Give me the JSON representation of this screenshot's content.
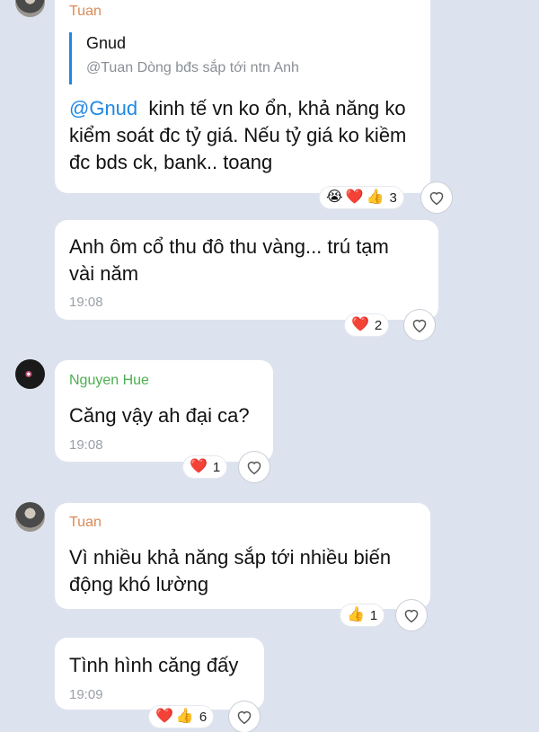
{
  "messages": [
    {
      "sender": "Tuan",
      "quote": {
        "name": "Gnud",
        "text": "@Tuan Dòng bđs sắp tới ntn Anh"
      },
      "mention": "@Gnud",
      "lines": [
        "kinh tế vn ko ổn, khả năng ko",
        "kiểm soát đc tỷ giá. Nếu tỷ giá ko kiềm",
        "đc bds ck, bank.. toang"
      ],
      "reactions": {
        "emojis": [
          "😭",
          "❤️",
          "👍"
        ],
        "count": "3"
      }
    },
    {
      "lines": [
        "Anh ôm cổ thu đô thu vàng... trú tạm",
        "vài năm"
      ],
      "time": "19:08",
      "reactions": {
        "emojis": [
          "❤️"
        ],
        "count": "2"
      }
    },
    {
      "sender": "Nguyen Hue",
      "lines": [
        "Căng vậy ah đại ca?"
      ],
      "time": "19:08",
      "reactions": {
        "emojis": [
          "❤️"
        ],
        "count": "1"
      }
    },
    {
      "sender": "Tuan",
      "lines": [
        "Vì nhiều khả năng sắp tới nhiều biến",
        "động khó lường"
      ],
      "reactions": {
        "emojis": [
          "👍"
        ],
        "count": "1"
      }
    },
    {
      "lines": [
        "Tình hình căng đấy"
      ],
      "time": "19:09",
      "reactions": {
        "emojis": [
          "❤️",
          "👍"
        ],
        "count": "6"
      }
    }
  ],
  "icons": {
    "like": "heart-outline-icon"
  },
  "colors": {
    "background": "#dde3ee",
    "mention": "#1e88e5",
    "tuan": "#d98a55",
    "hue": "#4caf50"
  }
}
